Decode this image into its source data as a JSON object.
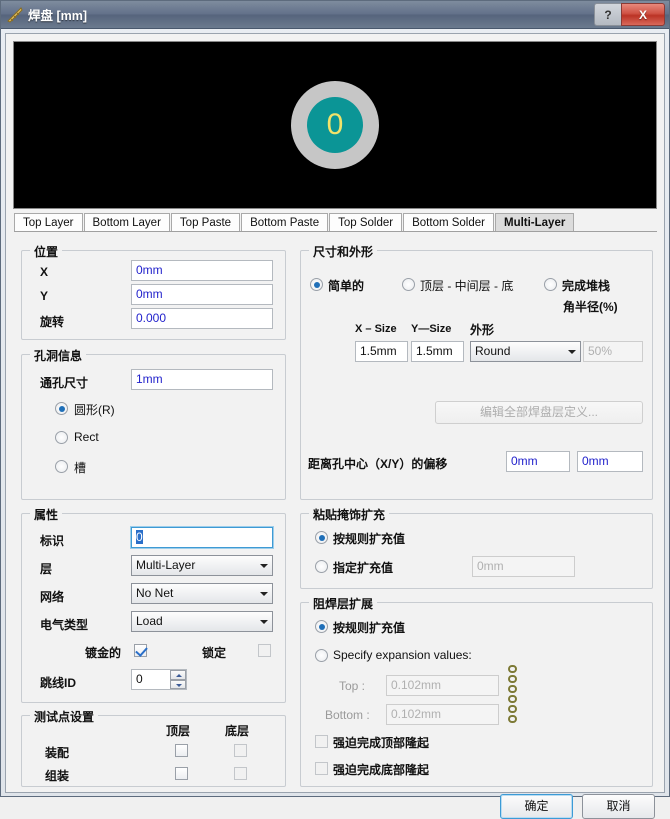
{
  "window": {
    "title": "焊盘 [mm]",
    "help_label": "?",
    "close_label": "X"
  },
  "preview": {
    "pad_designator": "0",
    "outer_color": "#c6c6c6",
    "inner_color": "#0b9596",
    "text_color": "#f2e36a",
    "background": "#000000"
  },
  "tabs": [
    {
      "label": "Top Layer",
      "selected": false
    },
    {
      "label": "Bottom Layer",
      "selected": false
    },
    {
      "label": "Top Paste",
      "selected": false
    },
    {
      "label": "Bottom Paste",
      "selected": false
    },
    {
      "label": "Top Solder",
      "selected": false
    },
    {
      "label": "Bottom Solder",
      "selected": false
    },
    {
      "label": "Multi-Layer",
      "selected": true
    }
  ],
  "location": {
    "title": "位置",
    "x_label": "X",
    "x_value": "0mm",
    "y_label": "Y",
    "y_value": "0mm",
    "rotation_label": "旋转",
    "rotation_value": "0.000"
  },
  "hole": {
    "title": "孔洞信息",
    "size_label": "通孔尺寸",
    "size_value": "1mm",
    "shape_round": "圆形(R)",
    "shape_rect": "Rect",
    "shape_slot": "槽",
    "selected_shape": "圆形(R)"
  },
  "properties": {
    "title": "属性",
    "designator_label": "标识",
    "designator_value": "0",
    "layer_label": "层",
    "layer_value": "Multi-Layer",
    "net_label": "网络",
    "net_value": "No Net",
    "electrical_label": "电气类型",
    "electrical_value": "Load",
    "plated_label": "镀金的",
    "plated_checked": true,
    "locked_label": "锁定",
    "locked_checked": false,
    "jumper_label": "跳线ID",
    "jumper_value": "0"
  },
  "testpoint": {
    "title": "测试点设置",
    "col_top": "顶层",
    "col_bottom": "底层",
    "row_fab": "装配",
    "row_assembly": "组装",
    "fab_top_checked": false,
    "fab_bottom_checked": false,
    "asm_top_checked": false,
    "asm_bottom_checked": false
  },
  "size_shape": {
    "title": "尺寸和外形",
    "mode_simple": "简单的",
    "mode_tml": "顶层 - 中间层 - 底层",
    "mode_full": "完成堆栈",
    "selected_mode": "简单的",
    "corner_radius_label": "角半径(%)",
    "col_x_size": "X – Size",
    "col_y_size": "Y—Size",
    "col_shape": "外形",
    "x_size_value": "1.5mm",
    "y_size_value": "1.5mm",
    "shape_value": "Round",
    "corner_radius_value": "50%",
    "edit_all_layers_button": "编辑全部焊盘层定义...",
    "offset_label": "距离孔中心（X/Y）的偏移",
    "offset_x": "0mm",
    "offset_y": "0mm"
  },
  "paste_mask": {
    "title": "粘贴掩饰扩充",
    "by_rule": "按规则扩充值",
    "specify": "指定扩充值",
    "selected": "按规则扩充值",
    "specify_value": "0mm"
  },
  "solder_mask": {
    "title": "阻焊层扩展",
    "by_rule": "按规则扩充值",
    "specify": "Specify expansion values:",
    "selected": "按规则扩充值",
    "top_label": "Top :",
    "top_value": "0.102mm",
    "bottom_label": "Bottom :",
    "bottom_value": "0.102mm",
    "force_top_label": "强迫完成顶部隆起",
    "force_top_checked": false,
    "force_bottom_label": "强迫完成底部隆起",
    "force_bottom_checked": false
  },
  "footer": {
    "ok_label": "确定",
    "cancel_label": "取消"
  }
}
